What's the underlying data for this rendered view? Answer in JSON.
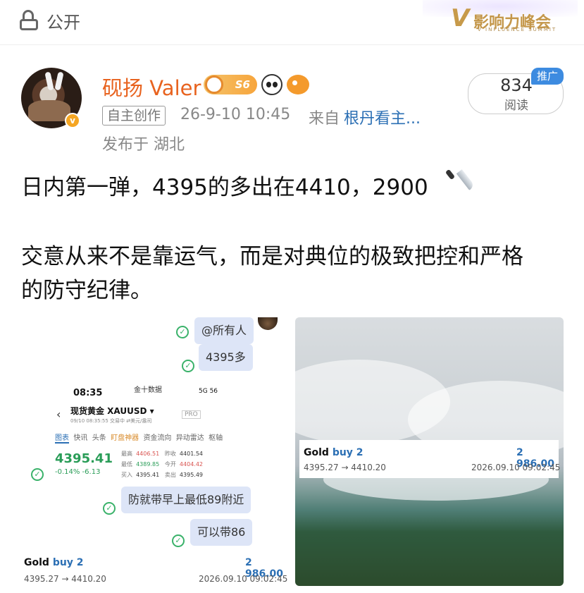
{
  "topbar": {
    "visibility_label": "公开",
    "logo_text": "影响力峰会",
    "logo_mark": "V",
    "logo_subtitle": "V INFLUENCE SUMMIT"
  },
  "author": {
    "name": "砚扬 Valer",
    "badge_level": "S6",
    "origin_tag": "自主创作",
    "post_time": "26-9-10 10:45",
    "from_label": "来自",
    "from_source": "根丹看主...",
    "location": "发布于 湖北"
  },
  "reads": {
    "count": "834",
    "label": "阅读",
    "promo": "推广"
  },
  "post": {
    "line1": "日内第一弹，4395的多出在4410，2900",
    "line2": "交意从来不是靠运气，而是对典位的极致把控和严格",
    "line3": "的防守纪律。"
  },
  "image1": {
    "bubble_all": "@所有人",
    "bubble_entry": "4395多",
    "phone": {
      "time": "08:35",
      "app": "金十数据",
      "signal": "5G",
      "battery": "56",
      "back": "‹",
      "instrument": "现货黄金 XAUUSD ▾",
      "sub": "09/10 08:35:55 交易中 ⇄美元/盎司",
      "pro": "PRO",
      "tabs": [
        "图表",
        "快讯",
        "头条",
        "盯盘神器",
        "资金流向",
        "异动雷达",
        "枢轴"
      ],
      "price": "4395.41",
      "change": "-0.14%  -6.13",
      "stats": [
        {
          "label": "最高",
          "value": "4406.51",
          "label2": "昨收",
          "value2": "4401.54"
        },
        {
          "label": "最低",
          "value": "4389.85",
          "label2": "今开",
          "value2": "4404.42"
        },
        {
          "label": "买入",
          "value": "4395.41",
          "label2": "卖出",
          "value2": "4395.49"
        }
      ]
    },
    "bubble_hint": "防就带早上最低89附近",
    "bubble_stop": "可以带86",
    "trade": {
      "symbol": "Gold",
      "side": "buy 2",
      "profit": "2 986.00",
      "range": "4395.27 → 4410.20",
      "datetime": "2026.09.10 09:02:45"
    }
  },
  "image2": {
    "trade": {
      "symbol": "Gold",
      "side": "buy 2",
      "profit": "2 986.00",
      "range": "4395.27 → 4410.20",
      "datetime": "2026.09.10 09:02:45"
    }
  },
  "colors": {
    "name": "#e8631f",
    "link": "#2b6fb4",
    "promo": "#3d8be0",
    "up": "#2a9d58"
  }
}
